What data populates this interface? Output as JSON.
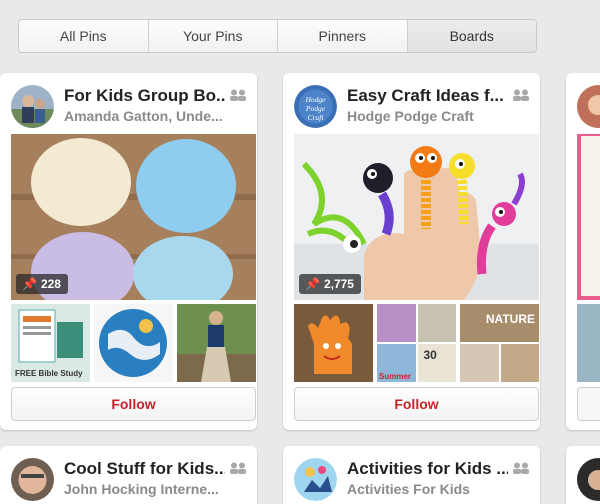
{
  "tabs": [
    {
      "label": "All Pins"
    },
    {
      "label": "Your Pins"
    },
    {
      "label": "Pinners"
    },
    {
      "label": "Boards",
      "active": true
    }
  ],
  "boards": [
    {
      "title": "For Kids Group Bo...",
      "owner": "Amanda Gatton, Unde...",
      "pin_count": "228",
      "follow_label": "Follow",
      "thumb_caption": "FREE Bible Study"
    },
    {
      "title": "Easy Craft Ideas f...",
      "owner": "Hodge Podge Craft",
      "pin_count": "2,775",
      "follow_label": "Follow",
      "avatar_text": "Hodge Podge Craft",
      "thumb_captions": [
        "30",
        "NATURE",
        "Summer"
      ]
    }
  ],
  "boards_row2": [
    {
      "title": "Cool Stuff for Kids...",
      "owner": "John Hocking Interne..."
    },
    {
      "title": "Activities for Kids ...",
      "owner": "Activities For Kids"
    }
  ],
  "colors": {
    "follow": "#c8232c",
    "background": "#e9e9e9"
  }
}
